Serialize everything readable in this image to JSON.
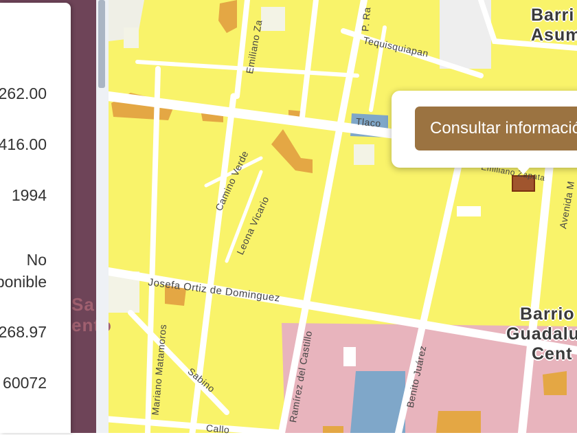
{
  "info_panel": {
    "values": [
      "262.00",
      "416.00",
      "1994",
      "No",
      "ponible",
      "268.97",
      "60072"
    ]
  },
  "map": {
    "street_labels": [
      "Emiliano Za",
      "P. Ra",
      "Tequisquiapan",
      "Tlaco",
      "Emiliano Zapata",
      "Camino Verde",
      "Leona Vicario",
      "Avenida M",
      "Josefa Ortiz de Dominguez",
      "Mariano Matamoros",
      "Sabino",
      "Ramírez del Castillo",
      "Benito Juárez",
      "Callo"
    ],
    "neighborhoods": {
      "asuncion_line1": "Barri",
      "asuncion_line2": "Asum",
      "guadalupe_line1": "Barrio",
      "guadalupe_line2": "Guadalu",
      "guadalupe_line3": "Cent",
      "side_line1": "Sa",
      "side_line2": "ento"
    },
    "colors": {
      "residential": "#f9f36a",
      "commercial": "#e8b4bd",
      "mixed": "#e4a744",
      "public": "#7fa7c9",
      "selected": "#a0552e"
    }
  },
  "popup": {
    "button_label": "Consultar información"
  }
}
